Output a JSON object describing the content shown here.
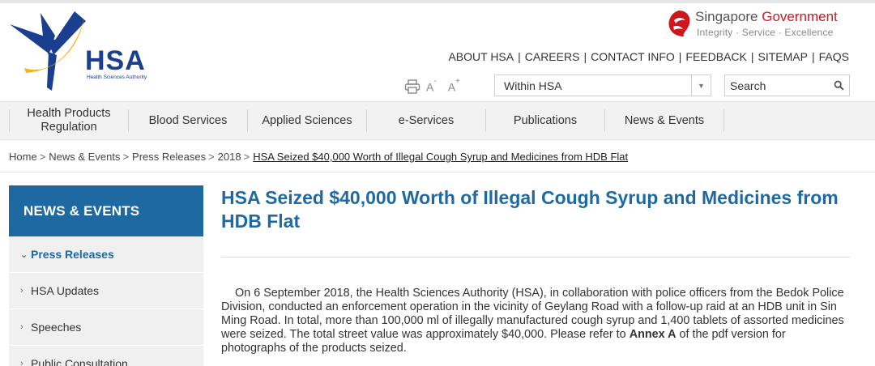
{
  "logo": {
    "name": "HSA",
    "subtitle": "Health Sciences Authority"
  },
  "gov_brand": {
    "title_part1": "Singapore ",
    "title_part2": "Government",
    "tagline": "Integrity · Service · Excellence"
  },
  "utility_nav": {
    "items": [
      "ABOUT HSA",
      "CAREERS",
      "CONTACT INFO",
      "FEEDBACK",
      "SITEMAP",
      "FAQS"
    ],
    "separator": "|"
  },
  "tools": {
    "font_decrease": "A",
    "font_decrease_mark": "-",
    "font_increase": "A",
    "font_increase_mark": "+"
  },
  "search": {
    "scope_value": "Within HSA",
    "placeholder": "Search"
  },
  "main_nav": {
    "items": [
      "Health Products Regulation",
      "Blood Services",
      "Applied Sciences",
      "e-Services",
      "Publications",
      "News & Events"
    ]
  },
  "breadcrumb": {
    "items": [
      "Home",
      "News & Events",
      "Press Releases",
      "2018"
    ],
    "current": "HSA Seized $40,000 Worth of Illegal Cough Syrup and Medicines from HDB Flat",
    "separator": ">"
  },
  "sidebar": {
    "heading": "NEWS & EVENTS",
    "items": [
      {
        "label": "Press Releases",
        "active": true,
        "chevron": "v"
      },
      {
        "label": "HSA Updates",
        "active": false,
        "chevron": ">"
      },
      {
        "label": "Speeches",
        "active": false,
        "chevron": ">"
      },
      {
        "label": "Public Consultation",
        "active": false,
        "chevron": ">"
      }
    ]
  },
  "article": {
    "title": "HSA Seized $40,000 Worth of Illegal Cough Syrup and Medicines from HDB Flat",
    "body_part1": "On 6 September 2018, the Health Sciences Authority (HSA), in collaboration with police officers from the Bedok Police Division, conducted an enforcement operation in the vicinity of Geylang Road with a follow-up raid at an HDB unit in Sin Ming Road. In total, more than 100,000 ml of illegally manufactured cough syrup and 1,400 tablets of assorted medicines were seized. The total street value was approximately $40,000. Please refer to ",
    "body_bold": "Annex A",
    "body_part2": " of the pdf version for photographs of the products seized."
  },
  "colors": {
    "brand_blue": "#1f69a3",
    "logo_navy": "#1b3f8f",
    "logo_yellow": "#f5b21b",
    "gov_red": "#d0161d",
    "nav_bg": "#f2f2f2",
    "sidebar_bg": "#f0f0f0"
  }
}
